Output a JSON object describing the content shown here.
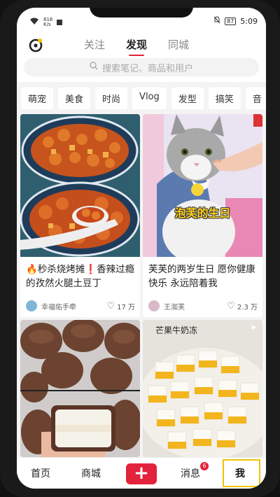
{
  "statusbar": {
    "speed": "816",
    "speed_unit": "K/s",
    "battery": "87",
    "time": "5:09"
  },
  "header": {
    "tabs": [
      {
        "label": "关注",
        "active": false
      },
      {
        "label": "发现",
        "active": true
      },
      {
        "label": "同城",
        "active": false
      }
    ]
  },
  "search": {
    "placeholder": "搜索笔记、商品和用户"
  },
  "categories": [
    "萌宠",
    "美食",
    "时尚",
    "Vlog",
    "发型",
    "搞笑",
    "音"
  ],
  "feed": [
    {
      "title": "🔥秒杀烧烤摊❗️香辣过瘾的孜然火腿土豆丁",
      "author": "幸福佑手牵",
      "likes": "17 万",
      "image": "food"
    },
    {
      "title": "芙芙的两岁生日 愿你健康快乐 永远陪着我",
      "author": "王洳芙",
      "likes": "2.3 万",
      "image": "cat",
      "overlay": "泡芙的生日"
    },
    {
      "image": "mochi"
    },
    {
      "image": "pudding",
      "overlay": "芒果牛奶冻"
    }
  ],
  "bottomnav": {
    "home": "首页",
    "mall": "商城",
    "plus": "+",
    "messages": "消息",
    "messages_badge": "6",
    "me": "我"
  },
  "colors": {
    "accent": "#e2233b",
    "highlight": "#f2c200"
  }
}
